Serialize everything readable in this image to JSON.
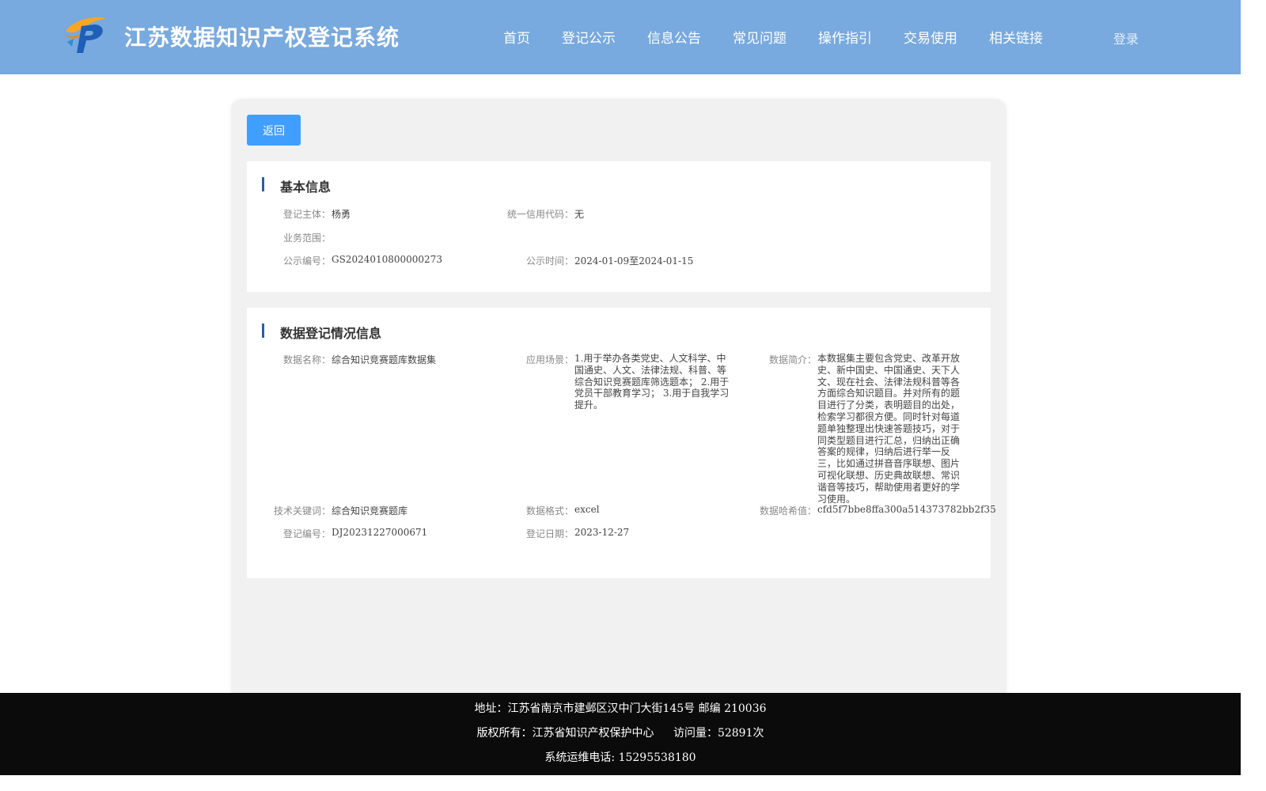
{
  "header": {
    "title": "江苏数据知识产权登记系统",
    "nav": [
      "首页",
      "登记公示",
      "信息公告",
      "常见问题",
      "操作指引",
      "交易使用",
      "相关链接"
    ],
    "login": "登录",
    "colors": {
      "header_bg": "#78a9df",
      "accent": "#409eff"
    }
  },
  "back_button": "返回",
  "basic_info": {
    "title": "基本信息",
    "subject_label": "登记主体：",
    "subject_value": "杨勇",
    "credit_code_label": "统一信用代码：",
    "credit_code_value": "无",
    "business_scope_label": "业务范围：",
    "business_scope_value": "",
    "notice_no_label": "公示编号：",
    "notice_no_value": "GS2024010800000273",
    "notice_time_label": "公示时间：",
    "notice_time_value": "2024-01-09至2024-01-15"
  },
  "registration_info": {
    "title": "数据登记情况信息",
    "data_name_label": "数据名称：",
    "data_name_value": "综合知识竞赛题库数据集",
    "scenario_label": "应用场景：",
    "scenario_value": "1.用于举办各类党史、人文科学、中国通史、人文、法律法规、科普、等综合知识竞赛题库筛选题本； 2.用于党员干部教育学习； 3.用于自我学习提升。",
    "summary_label": "数据简介：",
    "summary_value": "本数据集主要包含党史、改革开放史、新中国史、中国通史、天下人文、现在社会、法律法规科普等各方面综合知识题目。并对所有的题目进行了分类，表明题目的出处，检索学习都很方便。同时针对每道题单独整理出快速答题技巧，对于同类型题目进行汇总，归纳出正确答案的规律，归纳后进行举一反三，比如通过拼音音序联想、图片可视化联想、历史典故联想、常识谐音等技巧，帮助使用者更好的学习使用。",
    "keywords_label": "技术关键词：",
    "keywords_value": "综合知识竞赛题库",
    "format_label": "数据格式：",
    "format_value": "excel",
    "hash_label": "数据哈希值：",
    "hash_value": "cfd5f7bbe8ffa300a514373782bb2f35",
    "reg_no_label": "登记编号：",
    "reg_no_value": "DJ20231227000671",
    "reg_date_label": "登记日期：",
    "reg_date_value": "2023-12-27"
  },
  "footer": {
    "address": "地址：江苏省南京市建邺区汉中门大街145号 邮编 210036",
    "copyright": "版权所有：江苏省知识产权保护中心",
    "visits": "访问量：52891次",
    "hotline": "系统运维电话: 15295538180"
  }
}
